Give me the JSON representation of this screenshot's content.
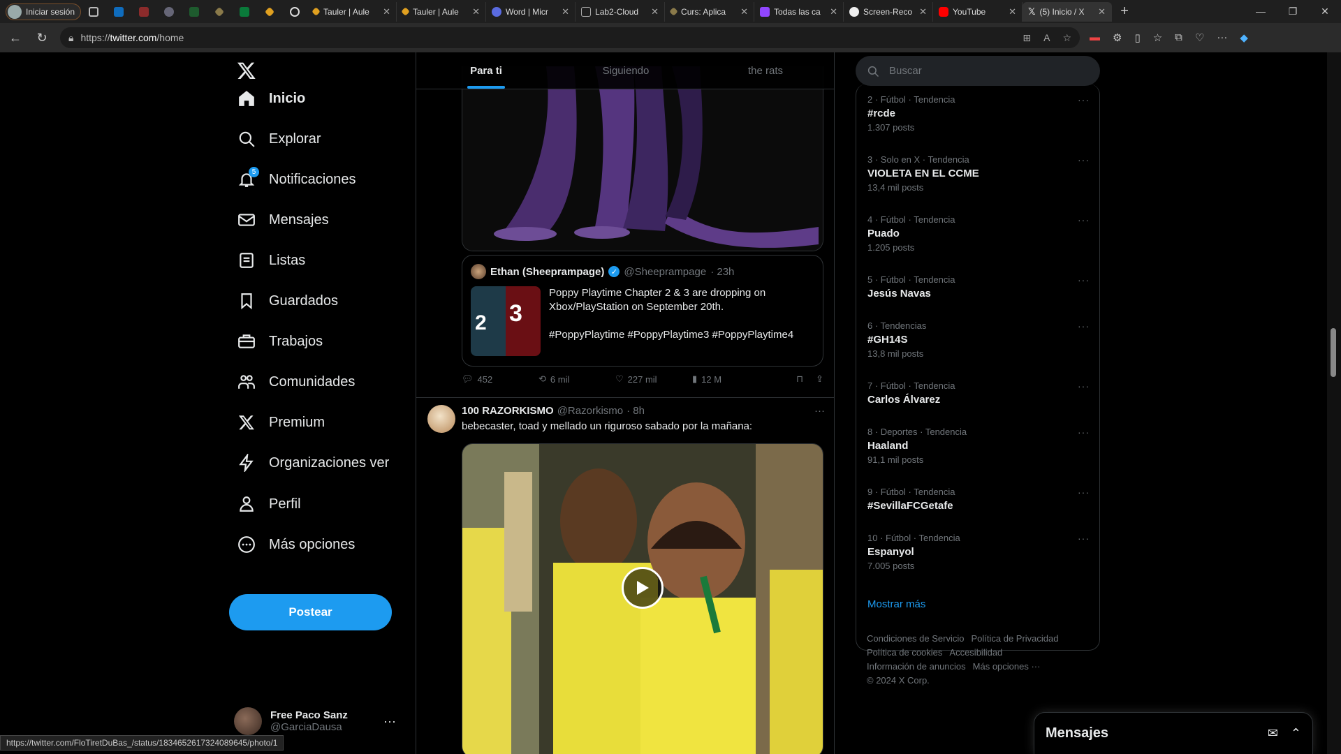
{
  "browser": {
    "profile_label": "Iniciar sesión",
    "tabs": [
      {
        "title": "Tauler | Aule",
        "active": false
      },
      {
        "title": "Tauler | Aule",
        "active": false
      },
      {
        "title": "Word | Micr",
        "active": false
      },
      {
        "title": "Lab2-Cloud",
        "active": false
      },
      {
        "title": "Curs: Aplica",
        "active": false
      },
      {
        "title": "Todas las ca",
        "active": false
      },
      {
        "title": "Screen-Reco",
        "active": false
      },
      {
        "title": "YouTube",
        "active": false
      },
      {
        "title": "(5) Inicio / X",
        "active": true
      }
    ],
    "url_scheme": "https://",
    "url_host": "twitter.com",
    "url_path": "/home",
    "status_url": "https://twitter.com/FloTiretDuBas_/status/1834652617324089645/photo/1"
  },
  "nav": {
    "items": [
      {
        "label": "Inicio",
        "icon": "home-icon"
      },
      {
        "label": "Explorar",
        "icon": "search-icon"
      },
      {
        "label": "Notificaciones",
        "icon": "bell-icon"
      },
      {
        "label": "Mensajes",
        "icon": "envelope-icon"
      },
      {
        "label": "Listas",
        "icon": "list-icon"
      },
      {
        "label": "Guardados",
        "icon": "bookmark-icon"
      },
      {
        "label": "Trabajos",
        "icon": "briefcase-icon"
      },
      {
        "label": "Comunidades",
        "icon": "people-icon"
      },
      {
        "label": "Premium",
        "icon": "x-icon"
      },
      {
        "label": "Organizaciones ver",
        "icon": "lightning-icon"
      },
      {
        "label": "Perfil",
        "icon": "person-icon"
      },
      {
        "label": "Más opciones",
        "icon": "more-circle-icon"
      }
    ],
    "notification_count": "5",
    "post_button": "Postear",
    "user_name": "Free Paco Sanz",
    "user_handle": "@GarciaDausa"
  },
  "timeline": {
    "tabs": [
      "Para ti",
      "Siguiendo",
      "the rats"
    ],
    "quote": {
      "name": "Ethan (Sheeprampage)",
      "handle": "@Sheeprampage",
      "time": "· 23h",
      "text1": "Poppy Playtime Chapter 2 & 3 are dropping on Xbox/PlayStation on September 20th.",
      "text2": "#PoppyPlaytime #PoppyPlaytime3 #PoppyPlaytime4",
      "thumb_left": "2",
      "thumb_right": "3"
    },
    "actions": {
      "replies": "452",
      "reposts": "6 mil",
      "likes": "227 mil",
      "views": "12 M"
    },
    "tweet2": {
      "name": "100 RAZORKISMO",
      "handle": "@Razorkismo",
      "time": "· 8h",
      "text": "bebecaster, toad y mellado un riguroso sabado por la mañana:"
    }
  },
  "right": {
    "search_placeholder": "Buscar",
    "trends": [
      {
        "meta": "2 · Fútbol · Tendencia",
        "name": "#rcde",
        "posts": "1.307 posts"
      },
      {
        "meta": "3 · Solo en X · Tendencia",
        "name": "VIOLETA EN EL CCME",
        "posts": "13,4 mil posts"
      },
      {
        "meta": "4 · Fútbol · Tendencia",
        "name": "Puado",
        "posts": "1.205 posts"
      },
      {
        "meta": "5 · Fútbol · Tendencia",
        "name": "Jesús Navas",
        "posts": ""
      },
      {
        "meta": "6 · Tendencias",
        "name": "#GH14S",
        "posts": "13,8 mil posts"
      },
      {
        "meta": "7 · Fútbol · Tendencia",
        "name": "Carlos Álvarez",
        "posts": ""
      },
      {
        "meta": "8 · Deportes · Tendencia",
        "name": "Haaland",
        "posts": "91,1 mil posts"
      },
      {
        "meta": "9 · Fútbol · Tendencia",
        "name": "#SevillaFCGetafe",
        "posts": ""
      },
      {
        "meta": "10 · Fútbol · Tendencia",
        "name": "Espanyol",
        "posts": "7.005 posts"
      }
    ],
    "show_more": "Mostrar más",
    "footer": {
      "tos": "Condiciones de Servicio",
      "privacy": "Política de Privacidad",
      "cookies": "Política de cookies",
      "accessibility": "Accesibilidad",
      "ads": "Información de anuncios",
      "more": "Más opciones ···",
      "copyright": "© 2024 X Corp."
    }
  },
  "messages_drawer": {
    "title": "Mensajes"
  },
  "colors": {
    "accent": "#1d9bf0",
    "background": "#000000",
    "border": "#2f3336",
    "muted": "#71767b"
  }
}
